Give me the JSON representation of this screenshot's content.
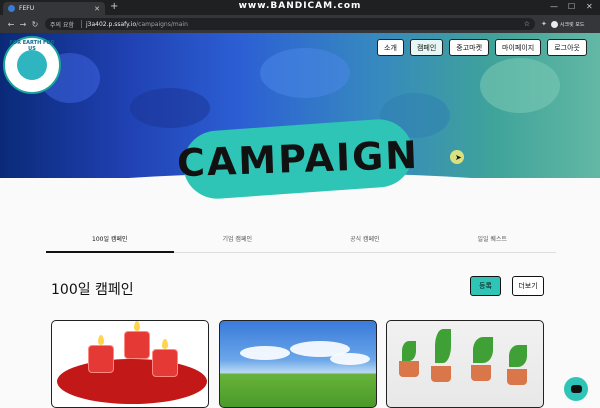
{
  "browser": {
    "tab_title": "FEFU",
    "tab_close": "✕",
    "new_tab": "+",
    "recorder_watermark": "www.BANDICAM.com",
    "address_warning": "주의 요함",
    "address_host": "j3a402.p.ssafy.io",
    "address_path": "/campaigns/main",
    "profile_label": "시크릿 모드"
  },
  "site": {
    "logo_text": "FOR EARTH FOR US"
  },
  "nav": {
    "items": [
      "소개",
      "캠페인",
      "중고마켓",
      "마이페이지",
      "로그아웃"
    ],
    "active_index": 1
  },
  "hero": {
    "title": "CAMPAIGN"
  },
  "tabs": {
    "items": [
      "100일 캠페인",
      "기업 캠페인",
      "공식 캠페인",
      "일일 퀘스트"
    ],
    "active_index": 0
  },
  "section": {
    "title": "100일 캠페인",
    "register_label": "등록",
    "more_label": "더보기"
  },
  "colors": {
    "accent": "#2ec4b6",
    "browser_dark": "#35363a"
  },
  "icons": {
    "back": "arrow-left-icon",
    "forward": "arrow-right-icon",
    "reload": "reload-icon",
    "star": "star-icon",
    "chat": "chat-icon"
  }
}
